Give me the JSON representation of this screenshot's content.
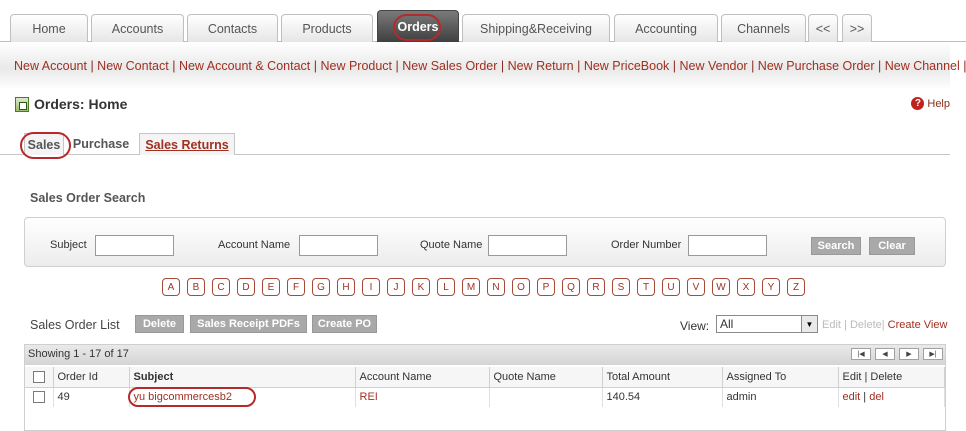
{
  "tabs": [
    {
      "label": "Home"
    },
    {
      "label": "Accounts"
    },
    {
      "label": "Contacts"
    },
    {
      "label": "Products"
    },
    {
      "label": "Orders"
    },
    {
      "label": "Shipping&Receiving"
    },
    {
      "label": "Accounting"
    },
    {
      "label": "Channels"
    },
    {
      "label": "<<"
    },
    {
      "label": ">>"
    }
  ],
  "quick_links": [
    "New Account",
    "New Contact",
    "New Account & Contact",
    "New Product",
    "New Sales Order",
    "New Return",
    "New PriceBook",
    "New Vendor",
    "New Purchase Order",
    "New Channel"
  ],
  "page_title": "Orders: Home",
  "help_label": "Help",
  "subtabs": [
    {
      "label": "Sales"
    },
    {
      "label": "Purchase"
    },
    {
      "label": "Sales Returns"
    }
  ],
  "search": {
    "title": "Sales Order Search",
    "subject_label": "Subject",
    "account_label": "Account Name",
    "quote_label": "Quote Name",
    "order_label": "Order Number",
    "search_btn": "Search",
    "clear_btn": "Clear"
  },
  "alphabet": [
    "A",
    "B",
    "C",
    "D",
    "E",
    "F",
    "G",
    "H",
    "I",
    "J",
    "K",
    "L",
    "M",
    "N",
    "O",
    "P",
    "Q",
    "R",
    "S",
    "T",
    "U",
    "V",
    "W",
    "X",
    "Y",
    "Z"
  ],
  "list": {
    "title": "Sales Order List",
    "delete_btn": "Delete",
    "receipt_btn": "Sales Receipt PDFs",
    "createpo_btn": "Create PO",
    "view_label": "View:",
    "view_value": "All",
    "edit_link": "Edit",
    "delete_link": "Delete",
    "create_view_link": "Create View",
    "showing": "Showing 1 - 17 of 17",
    "columns": [
      "Order Id",
      "Subject",
      "Account Name",
      "Quote Name",
      "Total Amount",
      "Assigned To",
      "Edit | Delete"
    ],
    "rows": [
      {
        "order_id": "49",
        "subject": "yu bigcommercesb2",
        "account": "REI",
        "quote": "",
        "total": "140.54",
        "assigned": "admin",
        "edit": "edit",
        "del": "del"
      }
    ]
  }
}
